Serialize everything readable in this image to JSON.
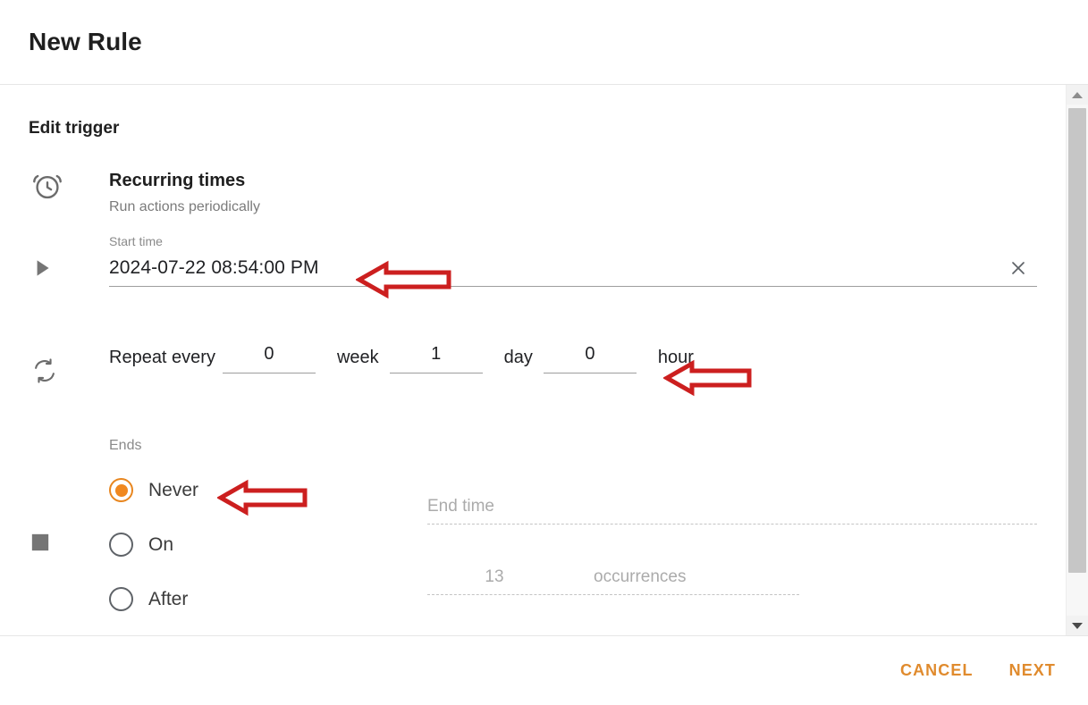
{
  "window": {
    "title": "New Rule"
  },
  "section": {
    "title": "Edit trigger"
  },
  "trigger": {
    "icon": "alarm-clock-icon",
    "name": "Recurring times",
    "description": "Run actions periodically"
  },
  "start_time": {
    "icon": "play-icon",
    "label": "Start time",
    "value": "2024-07-22 08:54:00 PM",
    "clear_icon": "close-icon"
  },
  "repeat": {
    "icon": "sync-icon",
    "label": "Repeat every",
    "fields": [
      {
        "value": "0",
        "unit": "week"
      },
      {
        "value": "1",
        "unit": "day"
      },
      {
        "value": "0",
        "unit": "hour"
      }
    ]
  },
  "ends": {
    "icon": "stop-square-icon",
    "label": "Ends",
    "options": [
      {
        "label": "Never",
        "selected": true
      },
      {
        "label": "On",
        "selected": false
      },
      {
        "label": "After",
        "selected": false
      }
    ],
    "end_time_placeholder": "End time",
    "occurrences_value": "13",
    "occurrences_unit": "occurrences"
  },
  "footer": {
    "cancel_label": "CANCEL",
    "next_label": "NEXT"
  },
  "scrollbar": {
    "up_icon": "chevron-up-icon",
    "down_icon": "chevron-down-icon"
  },
  "colors": {
    "accent": "#e08b2e",
    "radio_selected": "#f0881f",
    "annotation": "#cc1f1f",
    "text": "#202124",
    "muted": "#8a8a8a"
  }
}
